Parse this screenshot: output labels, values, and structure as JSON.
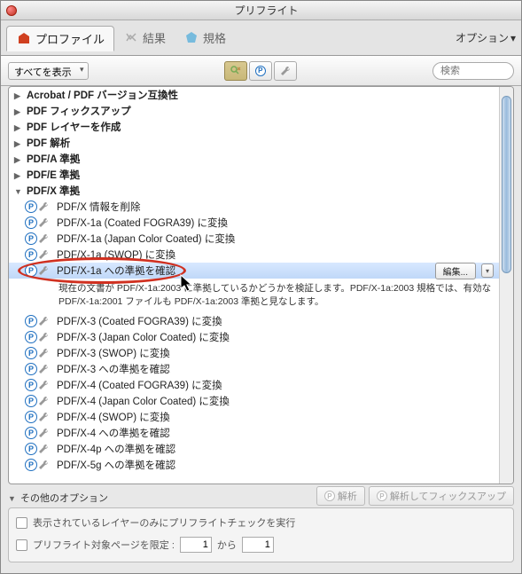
{
  "window": {
    "title": "プリフライト"
  },
  "tabs": {
    "profile": "プロファイル",
    "results": "結果",
    "standards": "規格",
    "options": "オプション"
  },
  "toolbar": {
    "filter": "すべてを表示",
    "search_placeholder": "検索"
  },
  "groups": [
    {
      "label": "Acrobat / PDF バージョン互換性",
      "open": false
    },
    {
      "label": "PDF フィックスアップ",
      "open": false
    },
    {
      "label": "PDF レイヤーを作成",
      "open": false
    },
    {
      "label": "PDF 解析",
      "open": false
    },
    {
      "label": "PDF/A 準拠",
      "open": false
    },
    {
      "label": "PDF/E 準拠",
      "open": false
    },
    {
      "label": "PDF/X 準拠",
      "open": true
    }
  ],
  "items_top": [
    "PDF/X 情報を削除",
    "PDF/X-1a (Coated FOGRA39) に変換",
    "PDF/X-1a (Japan Color Coated) に変換",
    "PDF/X-1a (SWOP) に変換"
  ],
  "selected": {
    "label": "PDF/X-1a への準拠を確認",
    "edit": "編集...",
    "desc": "現在の文書が PDF/X-1a:2003 に準拠しているかどうかを検証します。PDF/X-1a:2003 規格では、有効な PDF/X-1a:2001 ファイルも PDF/X-1a:2003 準拠と見なします。"
  },
  "items_bottom": [
    "PDF/X-3 (Coated FOGRA39) に変換",
    "PDF/X-3 (Japan Color Coated) に変換",
    "PDF/X-3 (SWOP) に変換",
    "PDF/X-3 への準拠を確認",
    "PDF/X-4 (Coated FOGRA39) に変換",
    "PDF/X-4 (Japan Color Coated) に変換",
    "PDF/X-4 (SWOP) に変換",
    "PDF/X-4 への準拠を確認",
    "PDF/X-4p への準拠を確認",
    "PDF/X-5g への準拠を確認"
  ],
  "footer": {
    "other_options": "その他のオプション",
    "analyze": "解析",
    "analyze_fix": "解析してフィックスアップ",
    "layers_only": "表示されているレイヤーのみにプリフライトチェックを実行",
    "page_range": "プリフライト対象ページを限定 :",
    "from": "1",
    "to_label": "から",
    "to": "1"
  }
}
